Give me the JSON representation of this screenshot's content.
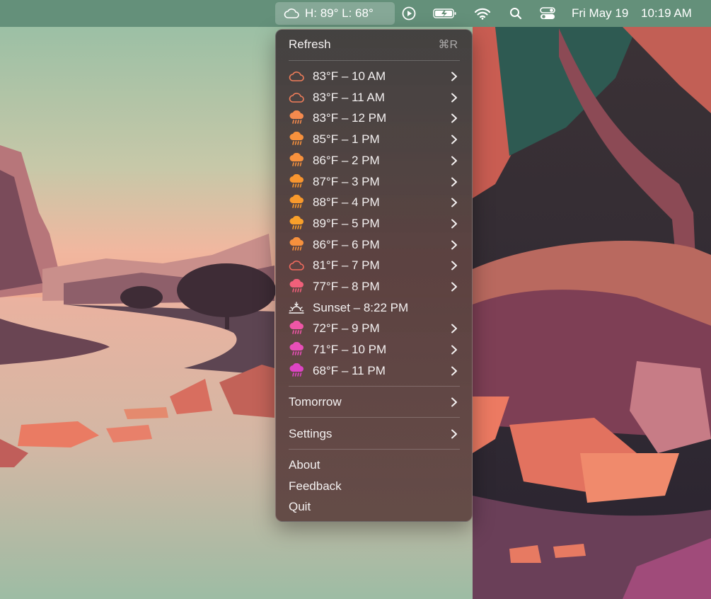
{
  "menubar": {
    "weather_text": "H: 89° L: 68°",
    "date": "Fri May 19",
    "time": "10:19 AM"
  },
  "menu": {
    "refresh_label": "Refresh",
    "refresh_shortcut": "⌘R",
    "hourly": [
      {
        "label": "83°F – 10 AM",
        "icon": "cloud-icon",
        "color": "#f07d5a"
      },
      {
        "label": "83°F – 11 AM",
        "icon": "cloud-icon",
        "color": "#f07d5a"
      },
      {
        "label": "83°F – 12 PM",
        "icon": "cloud-rain-icon",
        "color": "#f58a4e"
      },
      {
        "label": "85°F – 1 PM",
        "icon": "cloud-rain-icon",
        "color": "#f7913d"
      },
      {
        "label": "86°F – 2 PM",
        "icon": "cloud-rain-icon",
        "color": "#f7913d"
      },
      {
        "label": "87°F – 3 PM",
        "icon": "cloud-rain-icon",
        "color": "#f8952f"
      },
      {
        "label": "88°F – 4 PM",
        "icon": "cloud-rain-icon",
        "color": "#f8992c"
      },
      {
        "label": "89°F – 5 PM",
        "icon": "cloud-rain-icon",
        "color": "#f9a02a"
      },
      {
        "label": "86°F – 6 PM",
        "icon": "cloud-rain-icon",
        "color": "#f7913d"
      },
      {
        "label": "81°F – 7 PM",
        "icon": "cloud-icon",
        "color": "#f06a5e"
      },
      {
        "label": "77°F – 8 PM",
        "icon": "cloud-rain-icon",
        "color": "#f0607a"
      },
      {
        "label": "Sunset – 8:22 PM",
        "icon": "sunset-icon",
        "color": "#f4f1f1",
        "no_chevron": true
      },
      {
        "label": "72°F – 9 PM",
        "icon": "cloud-rain-icon",
        "color": "#ee56a6"
      },
      {
        "label": "71°F – 10 PM",
        "icon": "cloud-rain-icon",
        "color": "#e84fb8"
      },
      {
        "label": "68°F – 11 PM",
        "icon": "cloud-rain-icon",
        "color": "#dd45c4"
      }
    ],
    "tomorrow_label": "Tomorrow",
    "settings_label": "Settings",
    "about_label": "About",
    "feedback_label": "Feedback",
    "quit_label": "Quit"
  }
}
